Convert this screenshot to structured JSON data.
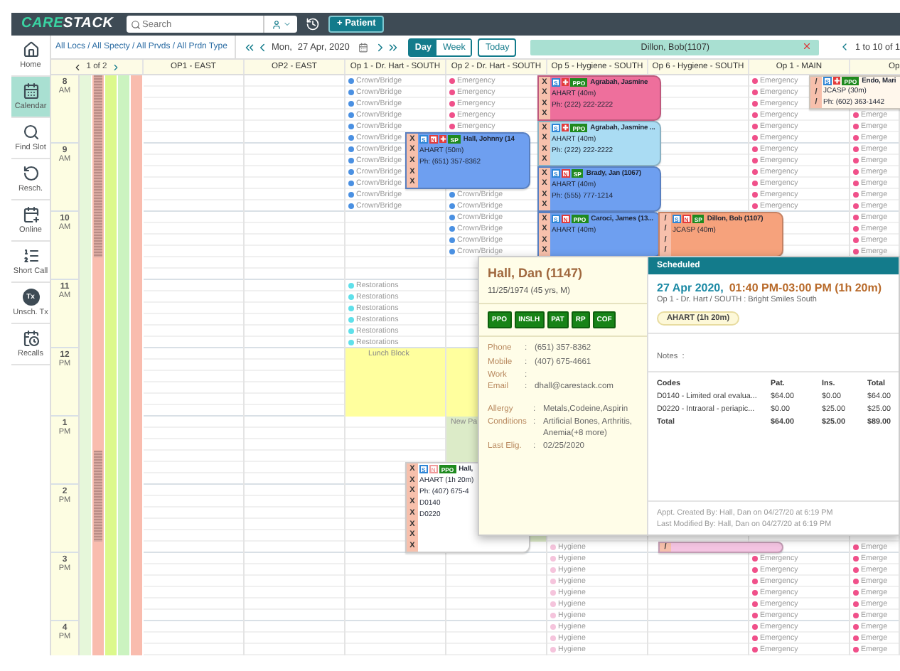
{
  "header": {
    "logo": {
      "accent": "CARE",
      "rest": "STACK"
    },
    "search": {
      "placeholder": "Search"
    },
    "new_patient_button": "+ Patient"
  },
  "sidebar": {
    "items": [
      {
        "label": "Home",
        "selected": false
      },
      {
        "label": "Calendar",
        "selected": true
      },
      {
        "label": "Find Slot",
        "selected": false
      },
      {
        "label": "Resch.",
        "selected": false
      },
      {
        "label": "Online",
        "selected": false
      },
      {
        "label": "Short Call",
        "selected": false
      },
      {
        "label": "Unsch. Tx",
        "badge": "Tx",
        "selected": false
      },
      {
        "label": "Recalls",
        "selected": false
      }
    ]
  },
  "toolbar": {
    "filter": "All Locs / All Specty / All Prvds / All Prdn Type",
    "day_name": "Mon,",
    "date": "27 Apr, 2020",
    "views": [
      {
        "label": "Day",
        "selected": true
      },
      {
        "label": "Week",
        "selected": false
      }
    ],
    "today_button": "Today",
    "patient_chip": "Dillon, Bob(1107)",
    "pager": "1 to 10 of 1"
  },
  "calendar": {
    "pager": "1 of 2",
    "hours": [
      {
        "hour": "8",
        "period": "AM"
      },
      {
        "hour": "9",
        "period": "AM"
      },
      {
        "hour": "10",
        "period": "AM"
      },
      {
        "hour": "11",
        "period": "AM"
      },
      {
        "hour": "12",
        "period": "PM"
      },
      {
        "hour": "1",
        "period": "PM"
      },
      {
        "hour": "2",
        "period": "PM"
      },
      {
        "hour": "3",
        "period": "PM"
      },
      {
        "hour": "4",
        "period": "PM"
      }
    ],
    "strips": [
      {
        "color": "#e6f7da",
        "hatched": false
      },
      {
        "color": "#f9bcae",
        "hatched": true
      },
      {
        "color": "#dcf98c",
        "hatched": false
      },
      {
        "color": "#cbf3c0",
        "hatched": false
      },
      {
        "color": "#f9bcae",
        "hatched": false
      }
    ],
    "columns": [
      {
        "title": "OP1 - EAST"
      },
      {
        "title": "OP2 - EAST"
      },
      {
        "title": "Op 1 - Dr. Hart - SOUTH",
        "slots": [
          {
            "kind": "type",
            "label": "Crown/Bridge",
            "color": "#4a90e2"
          },
          {
            "kind": "type",
            "label": "Crown/Bridge",
            "color": "#4a90e2"
          },
          {
            "kind": "type",
            "label": "Crown/Bridge",
            "color": "#4a90e2"
          },
          {
            "kind": "type",
            "label": "Crown/Bridge",
            "color": "#4a90e2"
          },
          {
            "kind": "type",
            "label": "Crown/Bridge",
            "color": "#4a90e2"
          },
          {
            "kind": "type",
            "label": "Crown/Bridge",
            "color": "#4a90e2",
            "appointment": {
              "kind": "side",
              "color": "#6e9ff0",
              "marks": [
                "X",
                "X",
                "X",
                "X",
                "X"
              ],
              "tags": [
                {
                  "kind": "outline",
                  "text": "S",
                  "color": "#2f86d6"
                },
                {
                  "kind": "outline",
                  "text": "N",
                  "color": "#e23b3b"
                },
                {
                  "kind": "cross",
                  "color": "#e23b3b"
                },
                {
                  "kind": "solid",
                  "text": "SP",
                  "color": "#1f8a1f"
                }
              ],
              "name": "Hall, Johnny (14",
              "lines": [
                "AHART (50m)",
                "Ph: (651) 357-8362"
              ]
            }
          },
          {
            "kind": "type",
            "label": "Crown/Bridge",
            "color": "#4a90e2"
          },
          {
            "kind": "type",
            "label": "Crown/Bridge",
            "color": "#4a90e2"
          },
          {
            "kind": "type",
            "label": "Crown/Bridge",
            "color": "#4a90e2"
          },
          {
            "kind": "type",
            "label": "Crown/Bridge",
            "color": "#4a90e2"
          },
          {
            "kind": "type",
            "label": "Crown/Bridge",
            "color": "#4a90e2"
          },
          {
            "kind": "type",
            "label": "Crown/Bridge",
            "color": "#4a90e2"
          },
          {
            "kind": "empty"
          },
          {
            "kind": "empty"
          },
          {
            "kind": "empty"
          },
          {
            "kind": "empty"
          },
          {
            "kind": "empty"
          },
          {
            "kind": "empty"
          },
          {
            "kind": "type",
            "label": "Restorations",
            "color": "#5fe0ea"
          },
          {
            "kind": "type",
            "label": "Restorations",
            "color": "#5fe0ea"
          },
          {
            "kind": "type",
            "label": "Restorations",
            "color": "#5fe0ea"
          },
          {
            "kind": "type",
            "label": "Restorations",
            "color": "#5fe0ea"
          },
          {
            "kind": "type",
            "label": "Restorations",
            "color": "#5fe0ea"
          },
          {
            "kind": "type",
            "label": "Restorations",
            "color": "#5fe0ea"
          },
          {
            "kind": "block",
            "label": "Lunch Block",
            "color": "#ffff9e"
          },
          {
            "kind": "continue"
          },
          {
            "kind": "continue"
          },
          {
            "kind": "continue"
          },
          {
            "kind": "continue"
          },
          {
            "kind": "continue"
          },
          {
            "kind": "empty"
          },
          {
            "kind": "empty"
          },
          {
            "kind": "empty"
          },
          {
            "kind": "empty"
          },
          {
            "kind": "empty",
            "appointment": {
              "kind": "side",
              "color": "#ffffff",
              "marks": [
                "X",
                "X",
                "X",
                "X",
                "X",
                "X",
                "X",
                "X"
              ],
              "tags": [
                {
                  "kind": "outline",
                  "text": "S",
                  "color": "#2f86d6"
                },
                {
                  "kind": "outline",
                  "text": "N",
                  "color": "#f09a9a"
                },
                {
                  "kind": "solid",
                  "text": "PPO",
                  "color": "#1f8a1f"
                }
              ],
              "name": "Hall,",
              "lines": [
                "AHART (1h 20m)",
                "Ph: (407) 675-4",
                "D0140",
                "D0220"
              ]
            }
          }
        ]
      },
      {
        "title": "Op 2 - Dr. Hart - SOUTH",
        "slots": [
          {
            "kind": "type",
            "label": "Emergency",
            "color": "#f0508a"
          },
          {
            "kind": "type",
            "label": "Emergency",
            "color": "#f0508a"
          },
          {
            "kind": "type",
            "label": "Emergency",
            "color": "#f0508a"
          },
          {
            "kind": "type",
            "label": "Emergency",
            "color": "#f0508a"
          },
          {
            "kind": "type",
            "label": "Emergency",
            "color": "#f0508a"
          },
          {
            "kind": "empty"
          },
          {
            "kind": "empty"
          },
          {
            "kind": "empty"
          },
          {
            "kind": "empty"
          },
          {
            "kind": "empty"
          },
          {
            "kind": "type",
            "label": "Crown/Bridge",
            "color": "#4a90e2"
          },
          {
            "kind": "type",
            "label": "Crown/Bridge",
            "color": "#4a90e2"
          },
          {
            "kind": "type",
            "label": "Crown/Bridge",
            "color": "#4a90e2"
          },
          {
            "kind": "type",
            "label": "Crown/Bridge",
            "color": "#4a90e2"
          },
          {
            "kind": "type",
            "label": "Crown/Bridge",
            "color": "#4a90e2"
          },
          {
            "kind": "type",
            "label": "Crown/Bridge",
            "color": "#4a90e2"
          },
          {
            "kind": "empty"
          },
          {
            "kind": "empty"
          },
          {
            "kind": "empty"
          },
          {
            "kind": "empty"
          },
          {
            "kind": "empty"
          },
          {
            "kind": "empty"
          },
          {
            "kind": "empty"
          },
          {
            "kind": "empty"
          },
          {
            "kind": "block",
            "color": "#ffff9e"
          },
          {
            "kind": "continue"
          },
          {
            "kind": "continue"
          },
          {
            "kind": "continue"
          },
          {
            "kind": "continue"
          },
          {
            "kind": "continue"
          },
          {
            "kind": "block",
            "label": "New Pa",
            "color": "#dcebc8"
          },
          {
            "kind": "continue"
          },
          {
            "kind": "continue"
          },
          {
            "kind": "continue"
          },
          {
            "kind": "continue"
          },
          {
            "kind": "continue"
          },
          {
            "kind": "continue"
          },
          {
            "kind": "continue"
          },
          {
            "kind": "continue"
          },
          {
            "kind": "continue"
          },
          {
            "kind": "continue"
          }
        ]
      },
      {
        "title": "Op 5 - Hygiene - SOUTH",
        "slots": [
          {
            "kind": "empty",
            "appointment": {
              "kind": "full",
              "color": "#ee6f9c",
              "marks": [
                "X",
                "X",
                "X",
                "X"
              ],
              "tags": [
                {
                  "kind": "outline",
                  "text": "S",
                  "color": "#2f86d6"
                },
                {
                  "kind": "cross",
                  "color": "#e23b3b"
                },
                {
                  "kind": "solid",
                  "text": "PPO",
                  "color": "#1f8a1f"
                }
              ],
              "name": "Agrabah, Jasmine",
              "lines": [
                "AHART (40m)",
                "Ph: (222) 222-2222"
              ]
            }
          },
          {
            "kind": "empty"
          },
          {
            "kind": "empty"
          },
          {
            "kind": "empty"
          },
          {
            "kind": "empty",
            "appointment": {
              "kind": "full",
              "color": "#aadcf3",
              "marks": [
                "X",
                "X",
                "X",
                "X"
              ],
              "tags": [
                {
                  "kind": "outline",
                  "text": "S",
                  "color": "#2f86d6"
                },
                {
                  "kind": "cross",
                  "color": "#e23b3b"
                },
                {
                  "kind": "solid",
                  "text": "PPO",
                  "color": "#1f8a1f"
                }
              ],
              "name": "Agrabah, Jasmine ...",
              "lines": [
                "AHART (40m)",
                "Ph: (222) 222-2222"
              ]
            }
          },
          {
            "kind": "empty"
          },
          {
            "kind": "empty"
          },
          {
            "kind": "empty"
          },
          {
            "kind": "empty",
            "appointment": {
              "kind": "full",
              "color": "#6e9ff0",
              "marks": [
                "X",
                "X",
                "X",
                "X"
              ],
              "tags": [
                {
                  "kind": "outline",
                  "text": "S",
                  "color": "#2f86d6"
                },
                {
                  "kind": "outline",
                  "text": "N",
                  "color": "#e23b3b"
                },
                {
                  "kind": "solid",
                  "text": "SP",
                  "color": "#1f8a1f"
                }
              ],
              "name": "Brady, Jan (1067)",
              "lines": [
                "AHART (40m)",
                "Ph: (555) 777-1214"
              ]
            }
          },
          {
            "kind": "empty"
          },
          {
            "kind": "empty"
          },
          {
            "kind": "empty"
          },
          {
            "kind": "empty",
            "appointment": {
              "kind": "full",
              "color": "#6e9ff0",
              "marks": [
                "X",
                "X",
                "X",
                "X"
              ],
              "tags": [
                {
                  "kind": "outline",
                  "text": "S",
                  "color": "#2f86d6"
                },
                {
                  "kind": "outline",
                  "text": "N",
                  "color": "#e23b3b"
                },
                {
                  "kind": "solid",
                  "text": "PPO",
                  "color": "#1f8a1f"
                }
              ],
              "name": "Caroci, James (13...",
              "lines": [
                "AHART (40m)"
              ]
            }
          },
          {
            "kind": "empty"
          },
          {
            "kind": "empty"
          },
          {
            "kind": "empty"
          },
          {
            "kind": "empty"
          },
          {
            "kind": "empty"
          },
          {
            "kind": "empty"
          },
          {
            "kind": "empty"
          },
          {
            "kind": "empty"
          },
          {
            "kind": "empty"
          },
          {
            "kind": "empty"
          },
          {
            "kind": "empty"
          },
          {
            "kind": "empty"
          },
          {
            "kind": "empty"
          },
          {
            "kind": "empty"
          },
          {
            "kind": "empty"
          },
          {
            "kind": "empty"
          },
          {
            "kind": "empty"
          },
          {
            "kind": "empty"
          },
          {
            "kind": "empty"
          },
          {
            "kind": "empty"
          },
          {
            "kind": "empty"
          },
          {
            "kind": "empty"
          },
          {
            "kind": "empty"
          },
          {
            "kind": "empty"
          },
          {
            "kind": "empty"
          },
          {
            "kind": "empty"
          },
          {
            "kind": "empty"
          },
          {
            "kind": "empty"
          },
          {
            "kind": "type",
            "label": "Hygiene",
            "color": "#f5c4dc"
          },
          {
            "kind": "type",
            "label": "Hygiene",
            "color": "#f5c4dc"
          },
          {
            "kind": "type",
            "label": "Hygiene",
            "color": "#f5c4dc"
          },
          {
            "kind": "type",
            "label": "Hygiene",
            "color": "#f5c4dc"
          },
          {
            "kind": "type",
            "label": "Hygiene",
            "color": "#f5c4dc"
          },
          {
            "kind": "type",
            "label": "Hygiene",
            "color": "#f5c4dc"
          },
          {
            "kind": "type",
            "label": "Hygiene",
            "color": "#f5c4dc"
          },
          {
            "kind": "type",
            "label": "Hygiene",
            "color": "#f5c4dc"
          },
          {
            "kind": "type",
            "label": "Hygiene",
            "color": "#f5c4dc"
          },
          {
            "kind": "type",
            "label": "Hygiene",
            "color": "#f5c4dc"
          }
        ]
      },
      {
        "title": "Op 6 - Hygiene - SOUTH",
        "slots": [
          {
            "kind": "empty"
          },
          {
            "kind": "empty"
          },
          {
            "kind": "empty"
          },
          {
            "kind": "empty"
          },
          {
            "kind": "empty"
          },
          {
            "kind": "empty"
          },
          {
            "kind": "empty"
          },
          {
            "kind": "empty"
          },
          {
            "kind": "empty"
          },
          {
            "kind": "empty"
          },
          {
            "kind": "empty"
          },
          {
            "kind": "empty"
          },
          {
            "kind": "empty",
            "appointment": {
              "kind": "inset",
              "color": "#f6a27c",
              "marks": [
                "/",
                "/",
                "/",
                "/"
              ],
              "tags": [
                {
                  "kind": "outline",
                  "text": "S",
                  "color": "#2f86d6"
                },
                {
                  "kind": "outline",
                  "text": "N",
                  "color": "#e23b3b"
                },
                {
                  "kind": "solid",
                  "text": "SP",
                  "color": "#1f8a1f"
                }
              ],
              "name": "Dillon, Bob (1107)",
              "lines": [
                "JCASP (40m)"
              ]
            }
          },
          {
            "kind": "empty"
          },
          {
            "kind": "empty"
          },
          {
            "kind": "empty"
          },
          {
            "kind": "empty"
          },
          {
            "kind": "empty"
          },
          {
            "kind": "empty"
          },
          {
            "kind": "empty"
          },
          {
            "kind": "empty"
          },
          {
            "kind": "empty"
          },
          {
            "kind": "empty"
          },
          {
            "kind": "empty"
          },
          {
            "kind": "empty"
          },
          {
            "kind": "empty"
          },
          {
            "kind": "empty"
          },
          {
            "kind": "empty"
          },
          {
            "kind": "empty"
          },
          {
            "kind": "empty"
          },
          {
            "kind": "empty"
          },
          {
            "kind": "empty"
          },
          {
            "kind": "empty"
          },
          {
            "kind": "empty"
          },
          {
            "kind": "empty"
          },
          {
            "kind": "empty"
          },
          {
            "kind": "empty"
          },
          {
            "kind": "empty"
          },
          {
            "kind": "empty"
          },
          {
            "kind": "empty"
          },
          {
            "kind": "empty"
          },
          {
            "kind": "empty",
            "appointment": {
              "kind": "inset",
              "color": "#f4c4e2",
              "marks": [
                "/"
              ]
            }
          }
        ]
      },
      {
        "title": "Op 1 - MAIN",
        "slots": [
          {
            "kind": "type",
            "label": "Emergency",
            "color": "#f0508a",
            "appointment": {
              "kind": "side",
              "color": "#fff7ec",
              "marks": [
                "/",
                "/",
                "/"
              ],
              "tags": [
                {
                  "kind": "outline",
                  "text": "S",
                  "color": "#2f86d6"
                },
                {
                  "kind": "cross",
                  "color": "#e23b3b"
                },
                {
                  "kind": "solid",
                  "text": "PPO",
                  "color": "#1f8a1f"
                }
              ],
              "name": "Endo, Mari",
              "lines": [
                "JCASP (30m)",
                "Ph: (602) 363-1442"
              ]
            }
          },
          {
            "kind": "type",
            "label": "Emergency",
            "color": "#f0508a"
          },
          {
            "kind": "type",
            "label": "Emergency",
            "color": "#f0508a"
          },
          {
            "kind": "type",
            "label": "Emergency",
            "color": "#f0508a"
          },
          {
            "kind": "type",
            "label": "Emergency",
            "color": "#f0508a"
          },
          {
            "kind": "type",
            "label": "Emergency",
            "color": "#f0508a"
          },
          {
            "kind": "type",
            "label": "Emergency",
            "color": "#f0508a"
          },
          {
            "kind": "type",
            "label": "Emergency",
            "color": "#f0508a"
          },
          {
            "kind": "type",
            "label": "Emergency",
            "color": "#f0508a"
          },
          {
            "kind": "type",
            "label": "Emergency",
            "color": "#f0508a"
          },
          {
            "kind": "type",
            "label": "Emergency",
            "color": "#f0508a"
          },
          {
            "kind": "type",
            "label": "Emergency",
            "color": "#f0508a"
          },
          {
            "kind": "empty"
          },
          {
            "kind": "empty"
          },
          {
            "kind": "empty"
          },
          {
            "kind": "empty"
          },
          {
            "kind": "empty"
          },
          {
            "kind": "empty"
          },
          {
            "kind": "empty"
          },
          {
            "kind": "empty"
          },
          {
            "kind": "empty"
          },
          {
            "kind": "empty"
          },
          {
            "kind": "empty"
          },
          {
            "kind": "empty"
          },
          {
            "kind": "empty"
          },
          {
            "kind": "empty"
          },
          {
            "kind": "empty"
          },
          {
            "kind": "empty"
          },
          {
            "kind": "empty"
          },
          {
            "kind": "empty"
          },
          {
            "kind": "empty"
          },
          {
            "kind": "empty"
          },
          {
            "kind": "empty"
          },
          {
            "kind": "empty"
          },
          {
            "kind": "empty"
          },
          {
            "kind": "empty"
          },
          {
            "kind": "empty"
          },
          {
            "kind": "empty"
          },
          {
            "kind": "empty"
          },
          {
            "kind": "empty"
          },
          {
            "kind": "empty"
          },
          {
            "kind": "empty"
          },
          {
            "kind": "type",
            "label": "Emergency",
            "color": "#f0508a"
          },
          {
            "kind": "type",
            "label": "Emergency",
            "color": "#f0508a"
          },
          {
            "kind": "type",
            "label": "Emergency",
            "color": "#f0508a"
          },
          {
            "kind": "type",
            "label": "Emergency",
            "color": "#f0508a"
          },
          {
            "kind": "type",
            "label": "Emergency",
            "color": "#f0508a"
          },
          {
            "kind": "type",
            "label": "Emergency",
            "color": "#f0508a"
          },
          {
            "kind": "type",
            "label": "Emergency",
            "color": "#f0508a"
          },
          {
            "kind": "type",
            "label": "Emergency",
            "color": "#f0508a"
          },
          {
            "kind": "type",
            "label": "Emergency",
            "color": "#f0508a"
          }
        ]
      },
      {
        "title": "Op",
        "slots": [
          {
            "kind": "empty"
          },
          {
            "kind": "empty"
          },
          {
            "kind": "empty"
          },
          {
            "kind": "type",
            "label": "Emerge",
            "color": "#f0508a"
          },
          {
            "kind": "type",
            "label": "Emerge",
            "color": "#f0508a"
          },
          {
            "kind": "type",
            "label": "Emerge",
            "color": "#f0508a"
          },
          {
            "kind": "type",
            "label": "Emerge",
            "color": "#f0508a"
          },
          {
            "kind": "type",
            "label": "Emerge",
            "color": "#f0508a"
          },
          {
            "kind": "type",
            "label": "Emerge",
            "color": "#f0508a"
          },
          {
            "kind": "type",
            "label": "Emerge",
            "color": "#f0508a"
          },
          {
            "kind": "type",
            "label": "Emerge",
            "color": "#f0508a"
          },
          {
            "kind": "type",
            "label": "Emerge",
            "color": "#f0508a"
          },
          {
            "kind": "type",
            "label": "Emerge",
            "color": "#f0508a"
          },
          {
            "kind": "type",
            "label": "Emerge",
            "color": "#f0508a"
          },
          {
            "kind": "type",
            "label": "Emerge",
            "color": "#f0508a"
          },
          {
            "kind": "type",
            "label": "Emerge",
            "color": "#f0508a"
          },
          {
            "kind": "empty"
          },
          {
            "kind": "empty"
          },
          {
            "kind": "empty"
          },
          {
            "kind": "empty"
          },
          {
            "kind": "empty"
          },
          {
            "kind": "empty"
          },
          {
            "kind": "empty"
          },
          {
            "kind": "empty"
          },
          {
            "kind": "empty"
          },
          {
            "kind": "empty"
          },
          {
            "kind": "empty"
          },
          {
            "kind": "empty"
          },
          {
            "kind": "empty"
          },
          {
            "kind": "empty"
          },
          {
            "kind": "empty"
          },
          {
            "kind": "empty"
          },
          {
            "kind": "empty"
          },
          {
            "kind": "empty"
          },
          {
            "kind": "empty"
          },
          {
            "kind": "empty"
          },
          {
            "kind": "empty"
          },
          {
            "kind": "empty"
          },
          {
            "kind": "empty"
          },
          {
            "kind": "empty"
          },
          {
            "kind": "empty"
          },
          {
            "kind": "type",
            "label": "Emerge",
            "color": "#f0508a"
          },
          {
            "kind": "type",
            "label": "Emerge",
            "color": "#f0508a"
          },
          {
            "kind": "type",
            "label": "Emerge",
            "color": "#f0508a"
          },
          {
            "kind": "type",
            "label": "Emerge",
            "color": "#f0508a"
          },
          {
            "kind": "type",
            "label": "Emerge",
            "color": "#f0508a"
          },
          {
            "kind": "type",
            "label": "Emerge",
            "color": "#f0508a"
          },
          {
            "kind": "type",
            "label": "Emerge",
            "color": "#f0508a"
          },
          {
            "kind": "type",
            "label": "Emerge",
            "color": "#f0508a"
          },
          {
            "kind": "type",
            "label": "Emerge",
            "color": "#f0508a"
          },
          {
            "kind": "type",
            "label": "Emerge",
            "color": "#f0508a"
          }
        ]
      }
    ]
  },
  "popup": {
    "patient": {
      "name": "Hall, Dan (1147)",
      "details": "11/25/1974 (45 yrs, M)",
      "badges": [
        "PPO",
        "INSLH",
        "PAT",
        "RP",
        "COF"
      ],
      "contacts": [
        {
          "label": "Phone",
          "sep": ":",
          "value": "(651) 357-8362"
        },
        {
          "label": "Mobile",
          "sep": ":",
          "value": "(407) 675-4661"
        },
        {
          "label": "Work",
          "sep": ":"
        },
        {
          "label": "Email",
          "sep": ":",
          "value": "dhall@carestack.com"
        }
      ],
      "medical": [
        {
          "label": "Allergy",
          "sep": ":",
          "value": "Metals,Codeine,Aspirin"
        },
        {
          "label": "Conditions",
          "sep": ":",
          "value": "Artificial Bones, Arthritis, Anemia(+8 more)"
        },
        {
          "label": "Last Elig.",
          "sep": ":",
          "value": "02/25/2020"
        }
      ]
    },
    "appointment": {
      "status": "Scheduled",
      "date": "27 Apr 2020,",
      "time": "01:40 PM-03:00 PM (1h 20m)",
      "location": "Op 1 - Dr. Hart / SOUTH : Bright Smiles South",
      "procedure": "AHART (1h 20m)",
      "notes": "Notes  :",
      "columns": [
        "Codes",
        "Pat.",
        "Ins.",
        "Total"
      ],
      "rows": [
        [
          "D0140 - Limited oral evalua...",
          "$64.00",
          "$0.00",
          "$64.00"
        ],
        [
          "D0220 - Intraoral - periapic...",
          "$0.00",
          "$25.00",
          "$25.00"
        ]
      ],
      "total": [
        "Total",
        "$64.00",
        "$25.00",
        "$89.00"
      ],
      "created": "Appt. Created By: Hall, Dan on 04/27/20 at 6:19 PM",
      "modified": "Last Modified By: Hall, Dan on 04/27/20 at 6:19 PM"
    }
  }
}
